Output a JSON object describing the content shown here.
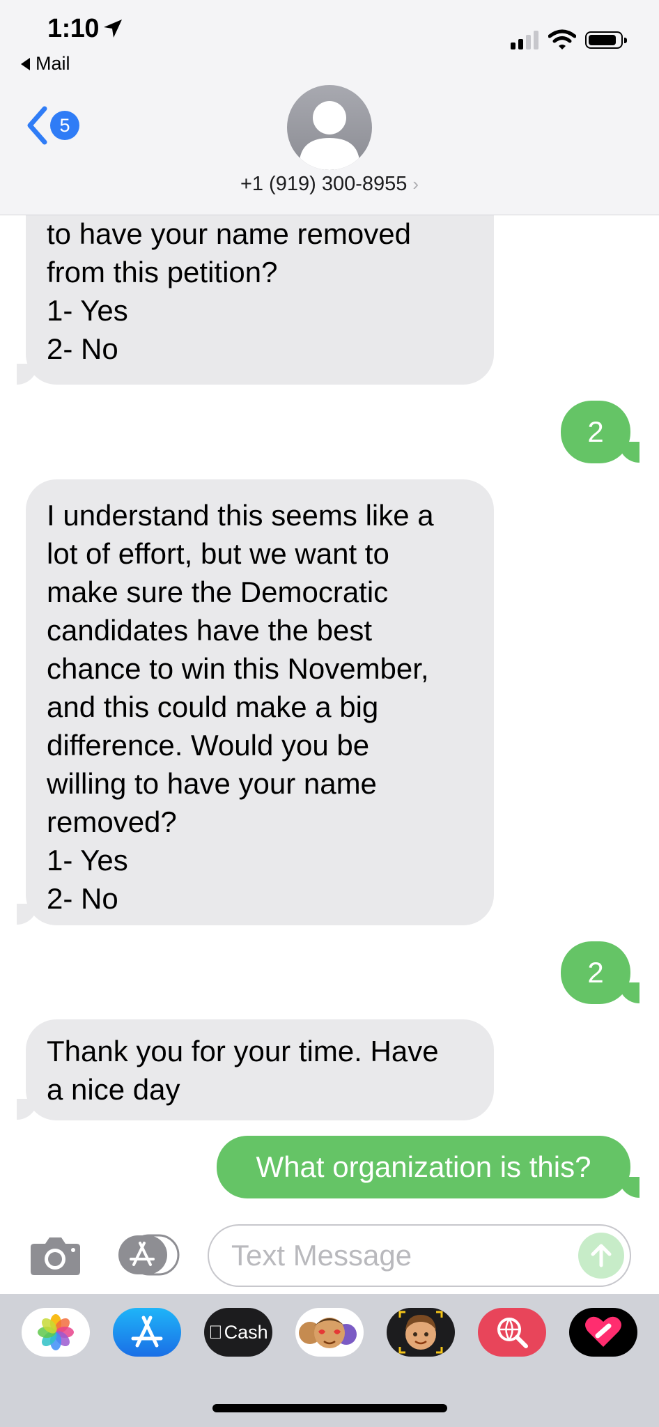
{
  "status_bar": {
    "time": "1:10",
    "back_app": "Mail"
  },
  "header": {
    "back_badge_count": "5",
    "contact": "+1 (919) 300-8955",
    "contact_chevron": "›"
  },
  "messages": [
    {
      "direction": "in",
      "text": "to have your name removed\nfrom this petition?\n1- Yes\n2- No"
    },
    {
      "direction": "out",
      "text": "2"
    },
    {
      "direction": "in",
      "text": "I understand this seems like a\nlot of effort, but we want to\nmake sure the Democratic\ncandidates have the best\nchance to win this November,\nand this could make a big\ndifference. Would you be\nwilling to have your name\nremoved?\n1- Yes\n2- No"
    },
    {
      "direction": "out",
      "text": "2"
    },
    {
      "direction": "in",
      "text": "Thank you for your time. Have\na nice day"
    },
    {
      "direction": "out",
      "text": "What organization is this?"
    }
  ],
  "input_bar": {
    "placeholder": "Text Message",
    "value": ""
  },
  "app_drawer": {
    "apps": [
      {
        "name": "photos-icon"
      },
      {
        "name": "app-store-icon"
      },
      {
        "name": "apple-cash-icon",
        "label": "Cash"
      },
      {
        "name": "animoji-icon"
      },
      {
        "name": "memoji-icon"
      },
      {
        "name": "web-search-icon"
      },
      {
        "name": "digital-touch-icon"
      }
    ]
  },
  "colors": {
    "incoming_bubble": "#e9e9eb",
    "outgoing_bubble": "#65c466",
    "accent": "#2f7cf6"
  }
}
